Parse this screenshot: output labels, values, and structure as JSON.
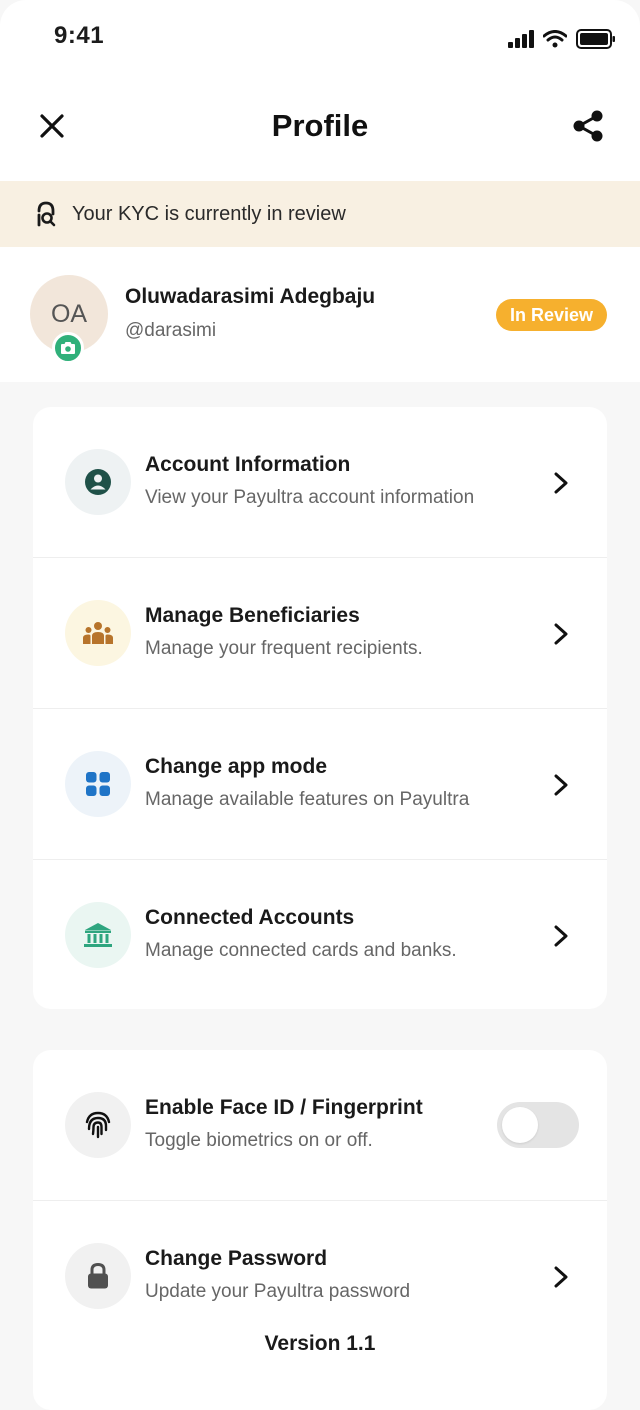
{
  "status_bar": {
    "time": "9:41",
    "icons": [
      "signal-icon",
      "wifi-icon",
      "battery-icon"
    ]
  },
  "nav": {
    "title": "Profile",
    "close_icon": "close-icon",
    "share_icon": "share-icon"
  },
  "kyc_banner": {
    "text": "Your KYC is currently in review",
    "icon": "kyc-review-icon"
  },
  "profile": {
    "initials": "OA",
    "name": "Oluwadarasimi Adegbaju",
    "handle": "@darasimi",
    "badge": "In Review"
  },
  "menu": [
    {
      "title": "Account Information",
      "subtitle": "View your Payultra account information",
      "icon": "user-circle-icon"
    },
    {
      "title": "Manage Beneficiaries",
      "subtitle": "Manage your frequent recipients.",
      "icon": "group-icon"
    },
    {
      "title": "Change app mode",
      "subtitle": "Manage available features on Payultra",
      "icon": "grid-icon"
    },
    {
      "title": "Connected Accounts",
      "subtitle": "Manage connected cards and banks.",
      "icon": "bank-icon"
    }
  ],
  "security": [
    {
      "title": "Enable Face ID / Fingerprint",
      "subtitle": "Toggle biometrics on or off.",
      "icon": "fingerprint-icon",
      "toggle_on": false
    },
    {
      "title": "Change Password",
      "subtitle": "Update your Payultra password",
      "icon": "lock-icon"
    }
  ],
  "version": "Version 1.1",
  "colors": {
    "accent_green": "#30b07a",
    "badge_orange": "#f6b02e",
    "banner_bg": "#f8f0e2",
    "blue": "#1f74c7",
    "brown": "#b7742b"
  }
}
